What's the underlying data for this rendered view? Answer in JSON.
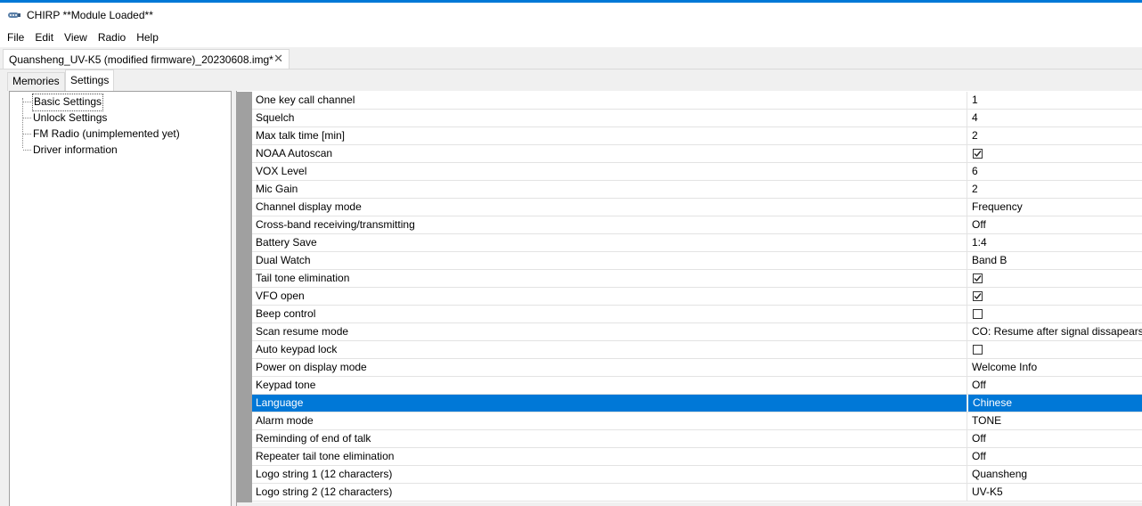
{
  "window": {
    "title": "CHIRP **Module Loaded**",
    "accent_color": "#0078d7"
  },
  "menu": [
    "File",
    "Edit",
    "View",
    "Radio",
    "Help"
  ],
  "file_tab": {
    "label": "Quansheng_UV-K5 (modified firmware)_20230608.img*",
    "close_glyph": "✕"
  },
  "view_tabs": {
    "memories": "Memories",
    "settings": "Settings",
    "active": "Settings"
  },
  "tree": {
    "items": [
      {
        "label": "Basic Settings",
        "selected": true
      },
      {
        "label": "Unlock Settings",
        "selected": false
      },
      {
        "label": "FM Radio (unimplemented yet)",
        "selected": false
      },
      {
        "label": "Driver information",
        "selected": false
      }
    ]
  },
  "settings": {
    "selected_color": "#0078d7",
    "rows": [
      {
        "name": "One key call channel",
        "type": "text",
        "value": "1"
      },
      {
        "name": "Squelch",
        "type": "text",
        "value": "4"
      },
      {
        "name": "Max talk time [min]",
        "type": "text",
        "value": "2"
      },
      {
        "name": "NOAA Autoscan",
        "type": "checkbox",
        "checked": true
      },
      {
        "name": "VOX Level",
        "type": "text",
        "value": "6"
      },
      {
        "name": "Mic Gain",
        "type": "text",
        "value": "2"
      },
      {
        "name": "Channel display mode",
        "type": "text",
        "value": "Frequency"
      },
      {
        "name": "Cross-band receiving/transmitting",
        "type": "text",
        "value": "Off"
      },
      {
        "name": "Battery Save",
        "type": "text",
        "value": "1:4"
      },
      {
        "name": "Dual Watch",
        "type": "text",
        "value": "Band B"
      },
      {
        "name": "Tail tone elimination",
        "type": "checkbox",
        "checked": true
      },
      {
        "name": "VFO open",
        "type": "checkbox",
        "checked": true
      },
      {
        "name": "Beep control",
        "type": "checkbox",
        "checked": false
      },
      {
        "name": "Scan resume mode",
        "type": "text",
        "value": "CO: Resume after signal dissapears"
      },
      {
        "name": "Auto keypad lock",
        "type": "checkbox",
        "checked": false
      },
      {
        "name": "Power on display mode",
        "type": "text",
        "value": "Welcome Info"
      },
      {
        "name": "Keypad tone",
        "type": "text",
        "value": "Off"
      },
      {
        "name": "Language",
        "type": "text",
        "value": "Chinese",
        "selected": true
      },
      {
        "name": "Alarm mode",
        "type": "text",
        "value": "TONE"
      },
      {
        "name": "Reminding of end of talk",
        "type": "text",
        "value": "Off"
      },
      {
        "name": "Repeater tail tone elimination",
        "type": "text",
        "value": "Off"
      },
      {
        "name": "Logo string 1 (12 characters)",
        "type": "text",
        "value": "Quansheng"
      },
      {
        "name": "Logo string 2 (12 characters)",
        "type": "text",
        "value": "UV-K5"
      }
    ]
  }
}
